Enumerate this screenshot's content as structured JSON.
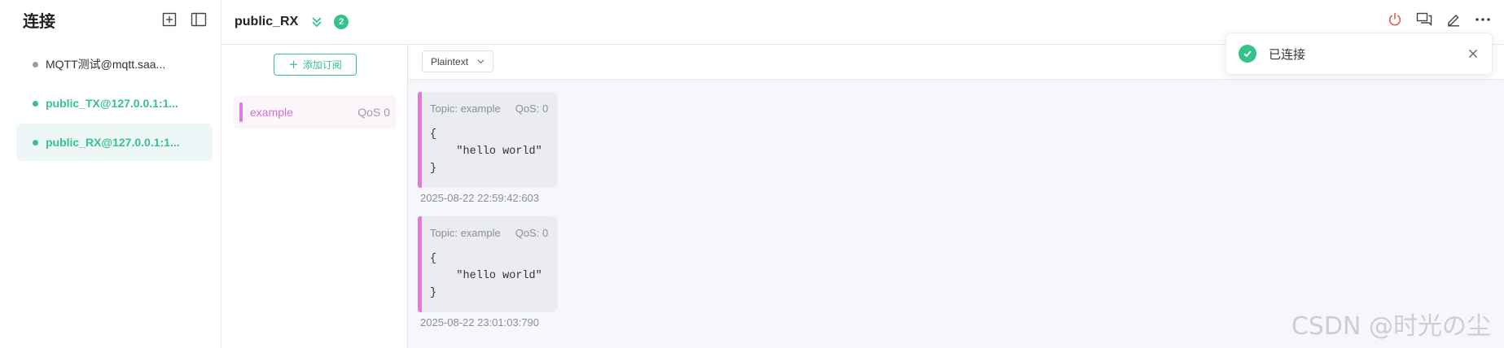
{
  "sidebar": {
    "title": "连接",
    "items": [
      {
        "label": "MQTT测试@mqtt.saa...",
        "status_color": "#9e9e9e",
        "text_color": "#333333"
      },
      {
        "label": "public_TX@127.0.0.1:1...",
        "status_color": "#34c388",
        "text_color": "#34c388"
      },
      {
        "label": "public_RX@127.0.0.1:1...",
        "status_color": "#34c388",
        "text_color": "#34c388"
      }
    ],
    "icons": [
      "new-window-icon",
      "sidebar-layout-icon"
    ]
  },
  "header": {
    "title": "public_RX",
    "badge": "2",
    "icons": [
      "double-chevron-down-icon",
      "power-icon",
      "chat-icon",
      "edit-icon",
      "more-icon"
    ]
  },
  "subscriptions": {
    "add_label": "添加订阅",
    "items": [
      {
        "topic": "example",
        "qos": "QoS 0",
        "color": "#e07ae0"
      }
    ]
  },
  "messages": {
    "format": "Plaintext",
    "list": [
      {
        "topic": "Topic: example",
        "qos": "QoS: 0",
        "payload": "{\n    \"hello world\"\n}",
        "time": "2025-08-22 22:59:42:603"
      },
      {
        "topic": "Topic: example",
        "qos": "QoS: 0",
        "payload": "{\n    \"hello world\"\n}",
        "time": "2025-08-22 23:01:03:790"
      }
    ]
  },
  "toast": {
    "text": "已连接",
    "icon": "check-circle-icon"
  },
  "watermark": "CSDN @时光の尘",
  "colors": {
    "accent": "#34c388",
    "topic": "#e07ae0",
    "power": "#e85a4f"
  }
}
